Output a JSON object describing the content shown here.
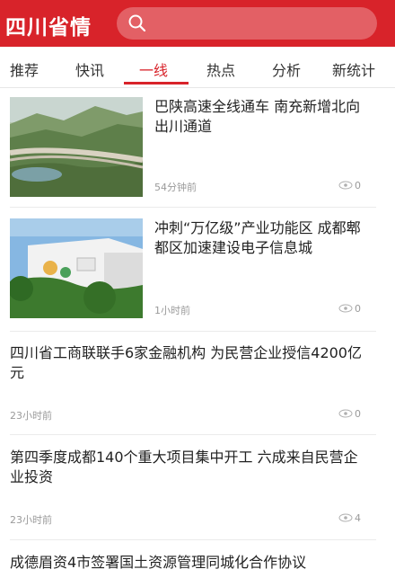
{
  "header": {
    "logo_text": "四川省情",
    "search_placeholder": ""
  },
  "tabs": [
    {
      "label": "推荐",
      "active": false
    },
    {
      "label": "快讯",
      "active": false
    },
    {
      "label": "一线",
      "active": true
    },
    {
      "label": "热点",
      "active": false
    },
    {
      "label": "分析",
      "active": false
    },
    {
      "label": "新统计",
      "active": false
    }
  ],
  "articles": [
    {
      "title": "巴陕高速全线通车 南充新增北向出川通道",
      "time": "54分钟前",
      "views": "0",
      "has_image": true,
      "image_icon": "highway-photo"
    },
    {
      "title": "冲刺“万亿级”产业功能区 成都郫都区加速建设电子信息城",
      "time": "1小时前",
      "views": "0",
      "has_image": true,
      "image_icon": "building-photo"
    },
    {
      "title": "四川省工商联联手6家金融机构 为民营企业授信4200亿元",
      "time": "23小时前",
      "views": "0",
      "has_image": false
    },
    {
      "title": "第四季度成都140个重大项目集中开工 六成来自民营企业投资",
      "time": "23小时前",
      "views": "4",
      "has_image": false
    },
    {
      "title": "成德眉资4市签署国土资源管理同城化合作协议",
      "has_image": false
    }
  ],
  "colors": {
    "brand": "#d8232a",
    "meta_text": "#9a9a9a"
  }
}
